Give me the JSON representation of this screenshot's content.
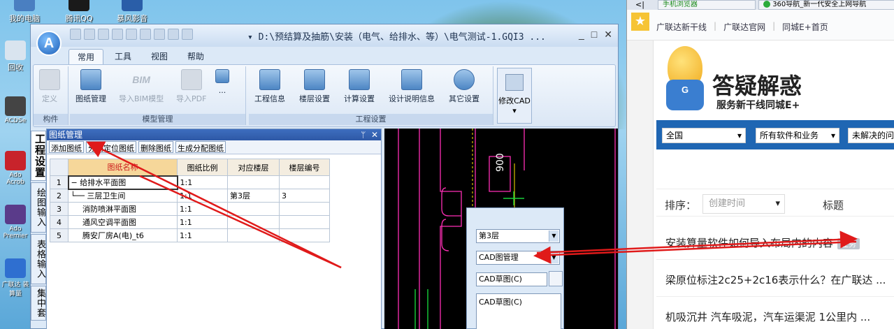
{
  "desktop": {
    "icons": [
      {
        "label": "我的电脑"
      },
      {
        "label": "腾讯QQ"
      },
      {
        "label": "暴风影音"
      },
      {
        "label": "回收"
      },
      {
        "label": "ACDSe"
      },
      {
        "label": "Ado Acrob"
      },
      {
        "label": "Ado Premier"
      },
      {
        "label": "广联达 装算量"
      }
    ]
  },
  "app": {
    "orb_letter": "A",
    "title": "▾ D:\\预结算及抽筋\\安装（电气、给排水、等）\\电气测试-1.GQI3 ...",
    "window_buttons": {
      "min": "_",
      "max": "□",
      "close": "✕"
    },
    "menu_tabs": [
      "常用",
      "工具",
      "视图",
      "帮助"
    ],
    "ribbon": {
      "groups": [
        {
          "label": "构件",
          "buttons": [
            "定义"
          ]
        },
        {
          "label": "模型管理",
          "buttons": [
            "图纸管理",
            "导入BIM模型",
            "导入PDF",
            "..."
          ]
        },
        {
          "label": "工程设置",
          "buttons": [
            "工程信息",
            "楼层设置",
            "计算设置",
            "设计说明信息",
            "其它设置"
          ]
        }
      ],
      "cad_button": "修改CAD",
      "bim_text": "BIM"
    },
    "side_tabs": [
      "工程设置",
      "绘图输入",
      "表格输入",
      "集中套"
    ],
    "panel": {
      "title": "图纸管理",
      "pin": "ᛘ",
      "close": "✕",
      "toolbar": [
        "添加图纸",
        "分割定位图纸",
        "删除图纸",
        "生成分配图纸"
      ],
      "columns": [
        "图纸名称",
        "图纸比例",
        "对应楼层",
        "楼层编号"
      ],
      "rows": [
        {
          "num": "1",
          "name": "− 给排水平面图",
          "scale": "1:1",
          "floor": "",
          "code": ""
        },
        {
          "num": "2",
          "name": "└── 三层卫生间",
          "scale": "1:1",
          "floor": "第3层",
          "code": "3"
        },
        {
          "num": "3",
          "name": "消防喷淋平面图",
          "scale": "1:1",
          "floor": "",
          "code": ""
        },
        {
          "num": "4",
          "name": "通风空调平面图",
          "scale": "1:1",
          "floor": "",
          "code": ""
        },
        {
          "num": "5",
          "name": "腾安厂房A(电)_t6",
          "scale": "1:1",
          "floor": "",
          "code": ""
        }
      ]
    },
    "cad_canvas": {
      "dim_text": "900"
    },
    "float_panel": {
      "floor_select": "第3层",
      "type_select": "CAD图管理",
      "draft_field": "CAD草图(C)",
      "list_item": "CAD草图(C)"
    }
  },
  "browser": {
    "tabs": [
      "手机浏览器",
      "360导航_新一代安全上网导航"
    ],
    "nav_back": "<|",
    "links": [
      "广联达新干线",
      "广联达官网",
      "同城E+首页"
    ],
    "hero": {
      "title": "答疑解惑",
      "subtitle": "服务新干线同城E+",
      "mascot_letter": "G"
    },
    "filters": [
      "全国",
      "所有软件和业务",
      "未解决的问"
    ],
    "sort": {
      "label": "排序：",
      "select": "创建时间",
      "title_col": "标题"
    },
    "questions": [
      {
        "text": "安装算量软件如何导入布局内的内容",
        "tag": "业务"
      },
      {
        "text": "梁原位标注2c25+2c16表示什么？在广联达 ..."
      },
      {
        "text": "机吸沉井 汽车吸泥，汽车运渠泥 1公里内 ..."
      }
    ]
  },
  "colors": {
    "ribbon_blue": "#dce9f7",
    "annotation_red": "#e01a1a",
    "filter_blue": "#1f66b3",
    "cad_bg": "#000000"
  }
}
